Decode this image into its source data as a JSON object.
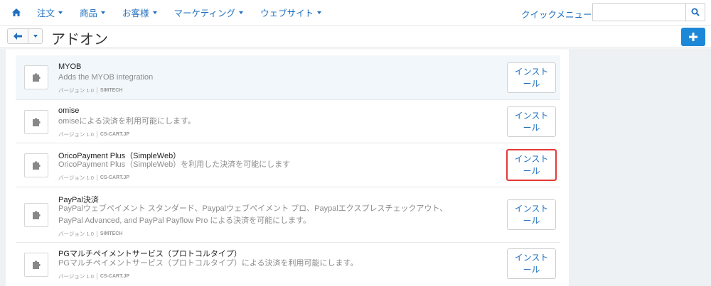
{
  "nav": {
    "items": [
      {
        "label": "注文"
      },
      {
        "label": "商品"
      },
      {
        "label": "お客様"
      },
      {
        "label": "マーケティング"
      },
      {
        "label": "ウェブサイト"
      }
    ],
    "quick_menu": "クイックメニュー",
    "search_value": ""
  },
  "header": {
    "title": "アドオン",
    "add_label": "+"
  },
  "addons": [
    {
      "name": "MYOB",
      "desc_lines": [
        "Adds the MYOB integration"
      ],
      "version": "バージョン 1.0",
      "author": "SIMTECH",
      "install_line1": "インスト",
      "install_line2": "ール"
    },
    {
      "name": "omise",
      "desc_lines": [
        "omiseによる決済を利用可能にします。"
      ],
      "version": "バージョン 1.0",
      "author": "CS-CART.JP",
      "install_line1": "インスト",
      "install_line2": "ール"
    },
    {
      "name": "OricoPayment Plus（SimpleWeb）",
      "desc_lines": [
        "OricoPayment Plus（SimpleWeb）を利用した決済を可能にします"
      ],
      "version": "バージョン 1.0",
      "author": "CS-CART.JP",
      "install_line1": "インスト",
      "install_line2": "ール"
    },
    {
      "name": "PayPal決済",
      "desc_lines": [
        "PayPalウェブペイメント スタンダード、Paypalウェブペイメント プロ、Paypalエクスプレスチェックアウト、",
        "PayPal Advanced, and PayPal Payflow Pro による決済を可能にします。"
      ],
      "version": "バージョン 1.0",
      "author": "SIMTECH",
      "install_line1": "インスト",
      "install_line2": "ール"
    },
    {
      "name": "PGマルチペイメントサービス（プロトコルタイプ）",
      "desc_lines": [
        "PGマルチペイメントサービス（プロトコルタイプ）による決済を利用可能にします。"
      ],
      "version": "バージョン 1.0",
      "author": "CS-CART.JP",
      "install_line1": "インスト",
      "install_line2": "ール"
    }
  ],
  "colors": {
    "link": "#1f6fbf",
    "primary": "#1e88d8",
    "highlight_row": "#f1f7fb",
    "focus_outline": "#e53935"
  },
  "icons": {
    "home": "home-icon",
    "search": "search-icon",
    "back": "arrow-left-icon",
    "addon": "puzzle-icon"
  }
}
